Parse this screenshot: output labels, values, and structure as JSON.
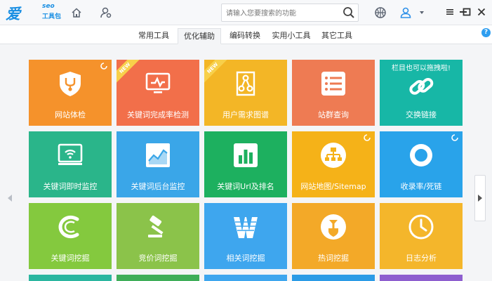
{
  "app": {
    "logo_main": "爱站",
    "logo_seo": "seo",
    "logo_sub": "工具包"
  },
  "search": {
    "placeholder": "请输入您要搜索的功能"
  },
  "tabs": [
    {
      "label": "常用工具",
      "active": false
    },
    {
      "label": "优化辅助",
      "active": true
    },
    {
      "label": "编码转换",
      "active": false
    },
    {
      "label": "实用小工具",
      "active": false
    },
    {
      "label": "其它工具",
      "active": false
    }
  ],
  "help_label": "?",
  "tiles": [
    {
      "label": "网站体检",
      "color": "#f5922b",
      "icon": "stethoscope-shield-icon",
      "spinner": true
    },
    {
      "label": "关键词完成率检测",
      "color": "#f26f4a",
      "icon": "monitor-chart-icon",
      "badge": "NEW"
    },
    {
      "label": "用户需求图谱",
      "color": "#f3b626",
      "icon": "graph-nodes-icon",
      "badge": "NEW"
    },
    {
      "label": "站群查询",
      "color": "#ee7b53",
      "icon": "list-icon"
    },
    {
      "label": "交换链接",
      "color": "#17b7a6",
      "icon": "chain-link-icon",
      "note": "栏目也可以拖拽啦!"
    },
    {
      "label": "关键词即时监控",
      "color": "#2ab58a",
      "icon": "wifi-monitor-icon"
    },
    {
      "label": "关键词后台监控",
      "color": "#3aa6e8",
      "icon": "trend-chart-icon"
    },
    {
      "label": "关键词Url及排名",
      "color": "#1db05f",
      "icon": "bar-chart-icon"
    },
    {
      "label": "网站地图/Sitemap",
      "color": "#f5b218",
      "icon": "sitemap-icon",
      "spinner": true
    },
    {
      "label": "收录率/死链",
      "color": "#29a3ea",
      "icon": "ring-icon",
      "spinner": true
    },
    {
      "label": "关键词挖掘",
      "color": "#84c93e",
      "icon": "letter-c-icon"
    },
    {
      "label": "竞价词挖掘",
      "color": "#8bc34a",
      "icon": "gavel-icon"
    },
    {
      "label": "相关词挖掘",
      "color": "#3ea6ee",
      "icon": "letter-w-icon"
    },
    {
      "label": "热词挖掘",
      "color": "#f3a928",
      "icon": "shovel-icon"
    },
    {
      "label": "日志分析",
      "color": "#f4b62b",
      "icon": "clock-icon"
    }
  ],
  "colors": {
    "accent": "#1a8fe3",
    "icon_gray": "#5a6270"
  }
}
